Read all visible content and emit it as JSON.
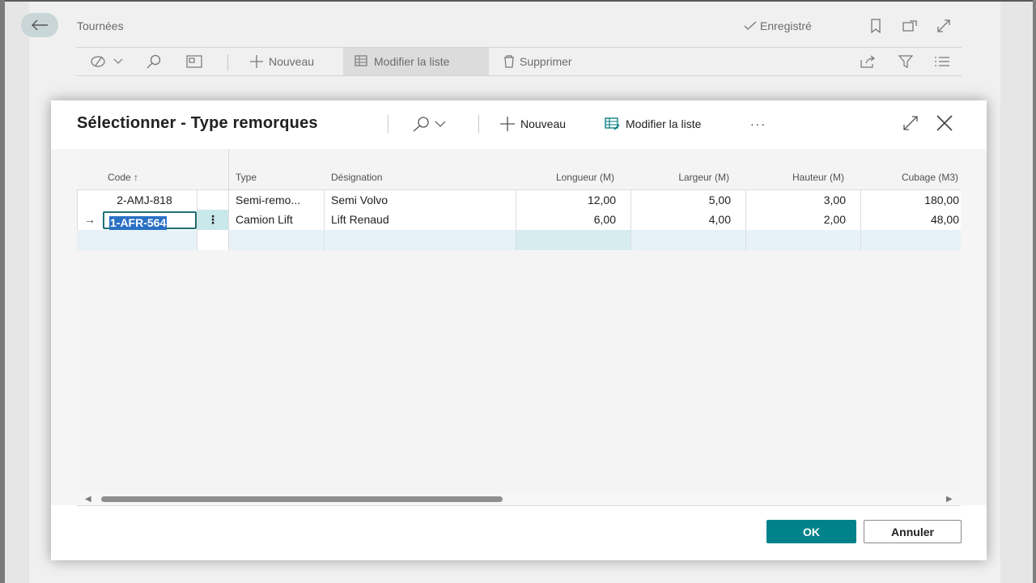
{
  "background": {
    "title": "Tournées",
    "saved_status": "Enregistré",
    "toolbar": {
      "new_label": "Nouveau",
      "edit_list_label": "Modifier la liste",
      "delete_label": "Supprimer"
    }
  },
  "dialog": {
    "title": "Sélectionner - Type remorques",
    "new_label": "Nouveau",
    "edit_list_label": "Modifier la liste",
    "more_label": "···",
    "columns": {
      "code": "Code ↑",
      "type": "Type",
      "designation": "Désignation",
      "longueur": "Longueur (M)",
      "largeur": "Largeur (M)",
      "hauteur": "Hauteur (M)",
      "cubage": "Cubage (M3)"
    },
    "rows": [
      {
        "code": "2-AMJ-818",
        "type": "Semi-remo...",
        "designation": "Semi Volvo",
        "longueur": "12,00",
        "largeur": "5,00",
        "hauteur": "3,00",
        "cubage": "180,00"
      },
      {
        "code": "1-AFR-564",
        "type": "Camion Lift",
        "designation": "Lift Renaud",
        "longueur": "6,00",
        "largeur": "4,00",
        "hauteur": "2,00",
        "cubage": "48,00"
      }
    ],
    "selected_row_marker": "→",
    "row_menu": "⋮",
    "ok_label": "OK",
    "cancel_label": "Annuler"
  },
  "colors": {
    "accent": "#00828a",
    "selection": "#2a71c5"
  }
}
